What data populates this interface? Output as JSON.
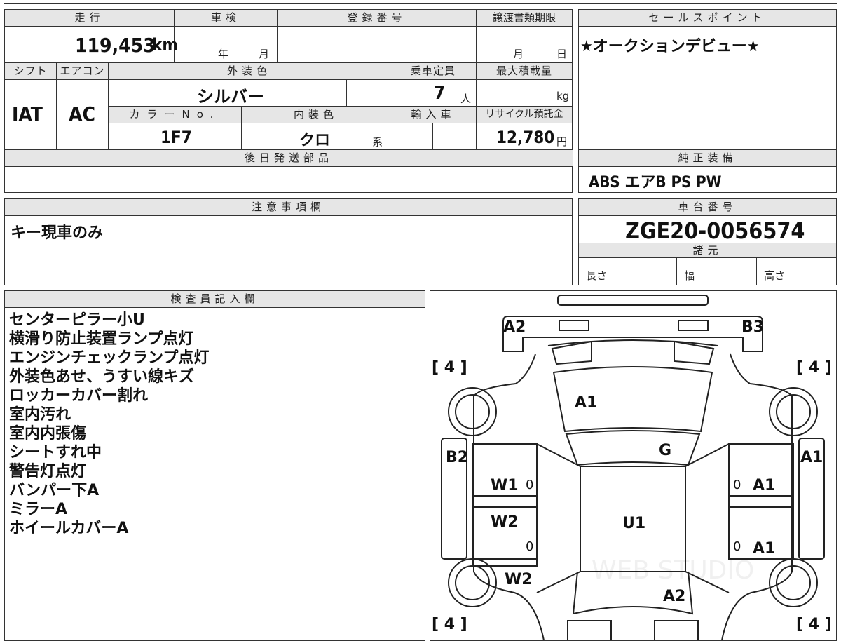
{
  "mileage": {
    "header": "走行",
    "value": "119,453",
    "unit": "km"
  },
  "shaken": {
    "header": "車検",
    "year_label": "年",
    "month_label": "月"
  },
  "registration": {
    "header": "登録番号"
  },
  "transfer_deadline": {
    "header": "譲渡書類期限",
    "month_label": "月",
    "day_label": "日"
  },
  "sales_point": {
    "header": "セールスポイント",
    "text": "★オークションデビュー★"
  },
  "shift": {
    "header": "シフト",
    "value": "IAT"
  },
  "aircon": {
    "header": "エアコン",
    "value": "AC"
  },
  "exterior_color": {
    "header": "外装色",
    "value": "シルバー"
  },
  "capacity": {
    "header": "乗車定員",
    "value": "7",
    "unit": "人"
  },
  "max_load": {
    "header": "最大積載量",
    "unit": "kg"
  },
  "color_no": {
    "header": "カラーNo.",
    "value": "1F7"
  },
  "interior_color": {
    "header": "内装色",
    "value": "クロ",
    "suffix": "系"
  },
  "import": {
    "header": "輸入車"
  },
  "recycle_fee": {
    "header": "リサイクル預託金",
    "value": "12,780",
    "unit": "円"
  },
  "later_parts": {
    "header": "後日発送部品"
  },
  "genuine_equipment": {
    "header": "純正装備",
    "value": "ABS エアB PS PW"
  },
  "notes": {
    "header": "注意事項欄",
    "text": "キー現車のみ"
  },
  "chassis": {
    "header": "車台番号",
    "value": "ZGE20-0056574"
  },
  "specs": {
    "header": "諸元",
    "length": "長さ",
    "width": "幅",
    "height": "高さ"
  },
  "inspector": {
    "header": "検査員記入欄",
    "lines": [
      "センターピラー小U",
      "横滑り防止装置ランプ点灯",
      "エンジンチェックランプ点灯",
      "外装色あせ、うすい線キズ",
      "ロッカーカバー割れ",
      "室内汚れ",
      "室内内張傷",
      "シートすれ中",
      "警告灯点灯",
      "バンパー下A",
      "ミラーA",
      "ホイールカバーA"
    ]
  },
  "diagram": {
    "labels": {
      "front_left": "A2",
      "front_right": "B3",
      "hood": "A1",
      "roof_front": "G",
      "roof": "U1",
      "rear": "A2",
      "left_front_door_pillar": "B2",
      "right_front_fender": "A1",
      "door_lf": "W1",
      "door_lr": "W2",
      "rear_quarter_left": "W2",
      "door_rf": "A1",
      "door_rr": "A1",
      "tire_fl": "[ 4 ]",
      "tire_fr": "[ 4 ]",
      "tire_rl": "[ 4 ]",
      "tire_rr": "[ 4 ]",
      "zero_1": "0",
      "zero_2": "0",
      "zero_3": "0",
      "zero_4": "0"
    },
    "watermark": "WEB STUDIO"
  }
}
